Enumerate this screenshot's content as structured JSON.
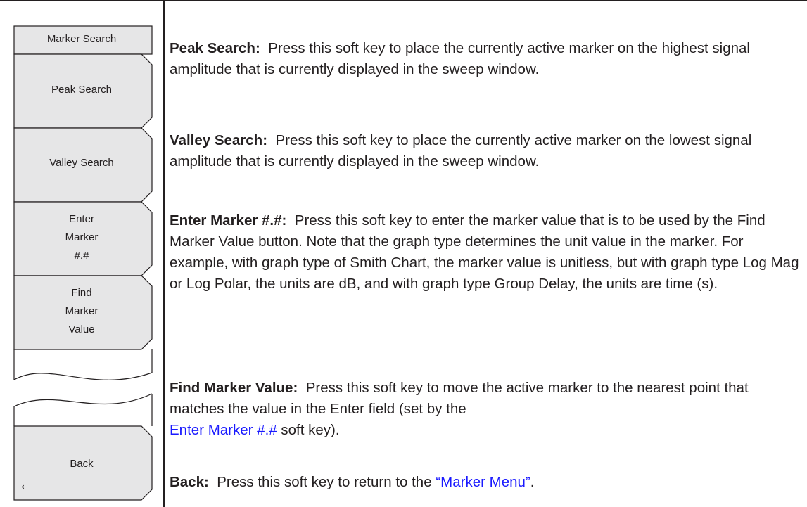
{
  "menu": {
    "title": "Marker Search",
    "keys": [
      {
        "label": "Peak Search"
      },
      {
        "label": "Valley Search"
      },
      {
        "label": "Enter\nMarker\n#.#"
      },
      {
        "label": "Find\nMarker\nValue"
      },
      {
        "label": "Back",
        "arrow": "←"
      }
    ]
  },
  "descriptions": [
    {
      "term": "Peak Search:",
      "text": "Press this soft key to place the currently active marker on the highest signal amplitude that is currently displayed in the sweep window."
    },
    {
      "term": "Valley Search:",
      "text": "Press this soft key to place the currently active marker on the lowest signal amplitude that is currently displayed in the sweep window."
    },
    {
      "term": "Enter Marker #.#:",
      "text": "Press this soft key to enter the marker value that is to be used by the Find Marker Value button. Note that the graph type determines the unit value in the marker. For example, with graph type of Smith Chart, the marker value is unitless, but with graph type Log Mag or Log Polar, the units are dB, and with graph type Group Delay, the units are time (s)."
    },
    {
      "term": "Find Marker Value:",
      "text": "Press this soft key to move the active marker to the nearest point that matches the value in the Enter field (set by the",
      "link": "Enter Marker #.#",
      "after": "soft key)."
    },
    {
      "term": "Back:",
      "text": "Press this soft key to return to the",
      "link": "“Marker Menu”",
      "after": "."
    }
  ],
  "colors": {
    "text": "#231f20",
    "key_fill": "#e6e6e7",
    "link": "#1a1aff"
  }
}
